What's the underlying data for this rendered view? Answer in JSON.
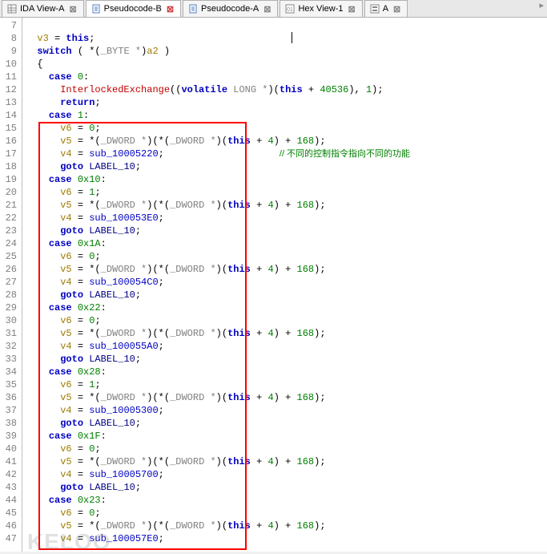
{
  "tabs": [
    {
      "icon": "sheet-icon",
      "label": "IDA View-A",
      "active": false
    },
    {
      "icon": "doc-icon",
      "label": "Pseudocode-B",
      "active": true,
      "redclose": true
    },
    {
      "icon": "doc-icon",
      "label": "Pseudocode-A",
      "active": false
    },
    {
      "icon": "hex-icon",
      "label": "Hex View-1",
      "active": false
    },
    {
      "icon": "struct-icon",
      "label": "A",
      "active": false
    }
  ],
  "gutter_start": 7,
  "gutter_end": 47,
  "comment": "// 不同的控制指令指向不同的功能",
  "watermark": "KELOO",
  "code_lines": [
    {
      "n": 7,
      "indent": 1,
      "tokens": []
    },
    {
      "n": 8,
      "indent": 1,
      "tokens": [
        [
          "var",
          "v3"
        ],
        [
          "p",
          " = "
        ],
        [
          "kw",
          "this"
        ],
        [
          "p",
          ";"
        ]
      ]
    },
    {
      "n": 9,
      "indent": 1,
      "tokens": [
        [
          "kw",
          "switch"
        ],
        [
          "p",
          " ( *("
        ],
        [
          "cast",
          "_BYTE *"
        ],
        [
          "p",
          ")"
        ],
        [
          "var",
          "a2"
        ],
        [
          "p",
          " )"
        ]
      ]
    },
    {
      "n": 10,
      "indent": 1,
      "tokens": [
        [
          "p",
          "{"
        ]
      ]
    },
    {
      "n": 11,
      "indent": 2,
      "tokens": [
        [
          "kw",
          "case"
        ],
        [
          "p",
          " "
        ],
        [
          "num",
          "0"
        ],
        [
          "p",
          ":"
        ]
      ]
    },
    {
      "n": 12,
      "indent": 3,
      "tokens": [
        [
          "func",
          "InterlockedExchange"
        ],
        [
          "p",
          "(("
        ],
        [
          "kw",
          "volatile"
        ],
        [
          "p",
          " "
        ],
        [
          "cast",
          "LONG *"
        ],
        [
          "p",
          ")("
        ],
        [
          "kw",
          "this"
        ],
        [
          "p",
          " + "
        ],
        [
          "num",
          "40536"
        ],
        [
          "p",
          "), "
        ],
        [
          "num",
          "1"
        ],
        [
          "p",
          ");"
        ]
      ]
    },
    {
      "n": 13,
      "indent": 3,
      "tokens": [
        [
          "kw",
          "return"
        ],
        [
          "p",
          ";"
        ]
      ]
    },
    {
      "n": 14,
      "indent": 2,
      "tokens": [
        [
          "kw",
          "case"
        ],
        [
          "p",
          " "
        ],
        [
          "num",
          "1"
        ],
        [
          "p",
          ":"
        ]
      ]
    },
    {
      "n": 15,
      "indent": 3,
      "tokens": [
        [
          "var",
          "v6"
        ],
        [
          "p",
          " = "
        ],
        [
          "num",
          "0"
        ],
        [
          "p",
          ";"
        ]
      ]
    },
    {
      "n": 16,
      "indent": 3,
      "tokens": [
        [
          "var",
          "v5"
        ],
        [
          "p",
          " = *("
        ],
        [
          "cast",
          "_DWORD *"
        ],
        [
          "p",
          ")(*("
        ],
        [
          "cast",
          "_DWORD *"
        ],
        [
          "p",
          ")("
        ],
        [
          "kw",
          "this"
        ],
        [
          "p",
          " + "
        ],
        [
          "num",
          "4"
        ],
        [
          "p",
          ") + "
        ],
        [
          "num",
          "168"
        ],
        [
          "p",
          ");"
        ]
      ]
    },
    {
      "n": 17,
      "indent": 3,
      "tokens": [
        [
          "var",
          "v4"
        ],
        [
          "p",
          " = "
        ],
        [
          "fn",
          "sub_10005220"
        ],
        [
          "p",
          ";"
        ]
      ],
      "comment": true
    },
    {
      "n": 18,
      "indent": 3,
      "tokens": [
        [
          "kw",
          "goto"
        ],
        [
          "p",
          " "
        ],
        [
          "label",
          "LABEL_10"
        ],
        [
          "p",
          ";"
        ]
      ]
    },
    {
      "n": 19,
      "indent": 2,
      "tokens": [
        [
          "kw",
          "case"
        ],
        [
          "p",
          " "
        ],
        [
          "num",
          "0x10"
        ],
        [
          "p",
          ":"
        ]
      ]
    },
    {
      "n": 20,
      "indent": 3,
      "tokens": [
        [
          "var",
          "v6"
        ],
        [
          "p",
          " = "
        ],
        [
          "num",
          "1"
        ],
        [
          "p",
          ";"
        ]
      ]
    },
    {
      "n": 21,
      "indent": 3,
      "tokens": [
        [
          "var",
          "v5"
        ],
        [
          "p",
          " = *("
        ],
        [
          "cast",
          "_DWORD *"
        ],
        [
          "p",
          ")(*("
        ],
        [
          "cast",
          "_DWORD *"
        ],
        [
          "p",
          ")("
        ],
        [
          "kw",
          "this"
        ],
        [
          "p",
          " + "
        ],
        [
          "num",
          "4"
        ],
        [
          "p",
          ") + "
        ],
        [
          "num",
          "168"
        ],
        [
          "p",
          ");"
        ]
      ]
    },
    {
      "n": 22,
      "indent": 3,
      "tokens": [
        [
          "var",
          "v4"
        ],
        [
          "p",
          " = "
        ],
        [
          "fn",
          "sub_100053E0"
        ],
        [
          "p",
          ";"
        ]
      ]
    },
    {
      "n": 23,
      "indent": 3,
      "tokens": [
        [
          "kw",
          "goto"
        ],
        [
          "p",
          " "
        ],
        [
          "label",
          "LABEL_10"
        ],
        [
          "p",
          ";"
        ]
      ]
    },
    {
      "n": 24,
      "indent": 2,
      "tokens": [
        [
          "kw",
          "case"
        ],
        [
          "p",
          " "
        ],
        [
          "num",
          "0x1A"
        ],
        [
          "p",
          ":"
        ]
      ]
    },
    {
      "n": 25,
      "indent": 3,
      "tokens": [
        [
          "var",
          "v6"
        ],
        [
          "p",
          " = "
        ],
        [
          "num",
          "0"
        ],
        [
          "p",
          ";"
        ]
      ]
    },
    {
      "n": 26,
      "indent": 3,
      "tokens": [
        [
          "var",
          "v5"
        ],
        [
          "p",
          " = *("
        ],
        [
          "cast",
          "_DWORD *"
        ],
        [
          "p",
          ")(*("
        ],
        [
          "cast",
          "_DWORD *"
        ],
        [
          "p",
          ")("
        ],
        [
          "kw",
          "this"
        ],
        [
          "p",
          " + "
        ],
        [
          "num",
          "4"
        ],
        [
          "p",
          ") + "
        ],
        [
          "num",
          "168"
        ],
        [
          "p",
          ");"
        ]
      ]
    },
    {
      "n": 27,
      "indent": 3,
      "tokens": [
        [
          "var",
          "v4"
        ],
        [
          "p",
          " = "
        ],
        [
          "fn",
          "sub_100054C0"
        ],
        [
          "p",
          ";"
        ]
      ]
    },
    {
      "n": 28,
      "indent": 3,
      "tokens": [
        [
          "kw",
          "goto"
        ],
        [
          "p",
          " "
        ],
        [
          "label",
          "LABEL_10"
        ],
        [
          "p",
          ";"
        ]
      ]
    },
    {
      "n": 29,
      "indent": 2,
      "tokens": [
        [
          "kw",
          "case"
        ],
        [
          "p",
          " "
        ],
        [
          "num",
          "0x22"
        ],
        [
          "p",
          ":"
        ]
      ]
    },
    {
      "n": 30,
      "indent": 3,
      "tokens": [
        [
          "var",
          "v6"
        ],
        [
          "p",
          " = "
        ],
        [
          "num",
          "0"
        ],
        [
          "p",
          ";"
        ]
      ]
    },
    {
      "n": 31,
      "indent": 3,
      "tokens": [
        [
          "var",
          "v5"
        ],
        [
          "p",
          " = *("
        ],
        [
          "cast",
          "_DWORD *"
        ],
        [
          "p",
          ")(*("
        ],
        [
          "cast",
          "_DWORD *"
        ],
        [
          "p",
          ")("
        ],
        [
          "kw",
          "this"
        ],
        [
          "p",
          " + "
        ],
        [
          "num",
          "4"
        ],
        [
          "p",
          ") + "
        ],
        [
          "num",
          "168"
        ],
        [
          "p",
          ");"
        ]
      ]
    },
    {
      "n": 32,
      "indent": 3,
      "tokens": [
        [
          "var",
          "v4"
        ],
        [
          "p",
          " = "
        ],
        [
          "fn",
          "sub_100055A0"
        ],
        [
          "p",
          ";"
        ]
      ]
    },
    {
      "n": 33,
      "indent": 3,
      "tokens": [
        [
          "kw",
          "goto"
        ],
        [
          "p",
          " "
        ],
        [
          "label",
          "LABEL_10"
        ],
        [
          "p",
          ";"
        ]
      ]
    },
    {
      "n": 34,
      "indent": 2,
      "tokens": [
        [
          "kw",
          "case"
        ],
        [
          "p",
          " "
        ],
        [
          "num",
          "0x28"
        ],
        [
          "p",
          ":"
        ]
      ]
    },
    {
      "n": 35,
      "indent": 3,
      "tokens": [
        [
          "var",
          "v6"
        ],
        [
          "p",
          " = "
        ],
        [
          "num",
          "1"
        ],
        [
          "p",
          ";"
        ]
      ]
    },
    {
      "n": 36,
      "indent": 3,
      "tokens": [
        [
          "var",
          "v5"
        ],
        [
          "p",
          " = *("
        ],
        [
          "cast",
          "_DWORD *"
        ],
        [
          "p",
          ")(*("
        ],
        [
          "cast",
          "_DWORD *"
        ],
        [
          "p",
          ")("
        ],
        [
          "kw",
          "this"
        ],
        [
          "p",
          " + "
        ],
        [
          "num",
          "4"
        ],
        [
          "p",
          ") + "
        ],
        [
          "num",
          "168"
        ],
        [
          "p",
          ");"
        ]
      ]
    },
    {
      "n": 37,
      "indent": 3,
      "tokens": [
        [
          "var",
          "v4"
        ],
        [
          "p",
          " = "
        ],
        [
          "fn",
          "sub_10005300"
        ],
        [
          "p",
          ";"
        ]
      ]
    },
    {
      "n": 38,
      "indent": 3,
      "tokens": [
        [
          "kw",
          "goto"
        ],
        [
          "p",
          " "
        ],
        [
          "label",
          "LABEL_10"
        ],
        [
          "p",
          ";"
        ]
      ]
    },
    {
      "n": 39,
      "indent": 2,
      "tokens": [
        [
          "kw",
          "case"
        ],
        [
          "p",
          " "
        ],
        [
          "num",
          "0x1F"
        ],
        [
          "p",
          ":"
        ]
      ]
    },
    {
      "n": 40,
      "indent": 3,
      "tokens": [
        [
          "var",
          "v6"
        ],
        [
          "p",
          " = "
        ],
        [
          "num",
          "0"
        ],
        [
          "p",
          ";"
        ]
      ]
    },
    {
      "n": 41,
      "indent": 3,
      "tokens": [
        [
          "var",
          "v5"
        ],
        [
          "p",
          " = *("
        ],
        [
          "cast",
          "_DWORD *"
        ],
        [
          "p",
          ")(*("
        ],
        [
          "cast",
          "_DWORD *"
        ],
        [
          "p",
          ")("
        ],
        [
          "kw",
          "this"
        ],
        [
          "p",
          " + "
        ],
        [
          "num",
          "4"
        ],
        [
          "p",
          ") + "
        ],
        [
          "num",
          "168"
        ],
        [
          "p",
          ");"
        ]
      ]
    },
    {
      "n": 42,
      "indent": 3,
      "tokens": [
        [
          "var",
          "v4"
        ],
        [
          "p",
          " = "
        ],
        [
          "fn",
          "sub_10005700"
        ],
        [
          "p",
          ";"
        ]
      ]
    },
    {
      "n": 43,
      "indent": 3,
      "tokens": [
        [
          "kw",
          "goto"
        ],
        [
          "p",
          " "
        ],
        [
          "label",
          "LABEL_10"
        ],
        [
          "p",
          ";"
        ]
      ]
    },
    {
      "n": 44,
      "indent": 2,
      "tokens": [
        [
          "kw",
          "case"
        ],
        [
          "p",
          " "
        ],
        [
          "num",
          "0x23"
        ],
        [
          "p",
          ":"
        ]
      ]
    },
    {
      "n": 45,
      "indent": 3,
      "tokens": [
        [
          "var",
          "v6"
        ],
        [
          "p",
          " = "
        ],
        [
          "num",
          "0"
        ],
        [
          "p",
          ";"
        ]
      ]
    },
    {
      "n": 46,
      "indent": 3,
      "tokens": [
        [
          "var",
          "v5"
        ],
        [
          "p",
          " = *("
        ],
        [
          "cast",
          "_DWORD *"
        ],
        [
          "p",
          ")(*("
        ],
        [
          "cast",
          "_DWORD *"
        ],
        [
          "p",
          ")("
        ],
        [
          "kw",
          "this"
        ],
        [
          "p",
          " + "
        ],
        [
          "num",
          "4"
        ],
        [
          "p",
          ") + "
        ],
        [
          "num",
          "168"
        ],
        [
          "p",
          ");"
        ]
      ]
    },
    {
      "n": 47,
      "indent": 3,
      "tokens": [
        [
          "var",
          "v4"
        ],
        [
          "p",
          " = "
        ],
        [
          "fn",
          "sub_100057E0"
        ],
        [
          "p",
          ";"
        ]
      ]
    }
  ]
}
